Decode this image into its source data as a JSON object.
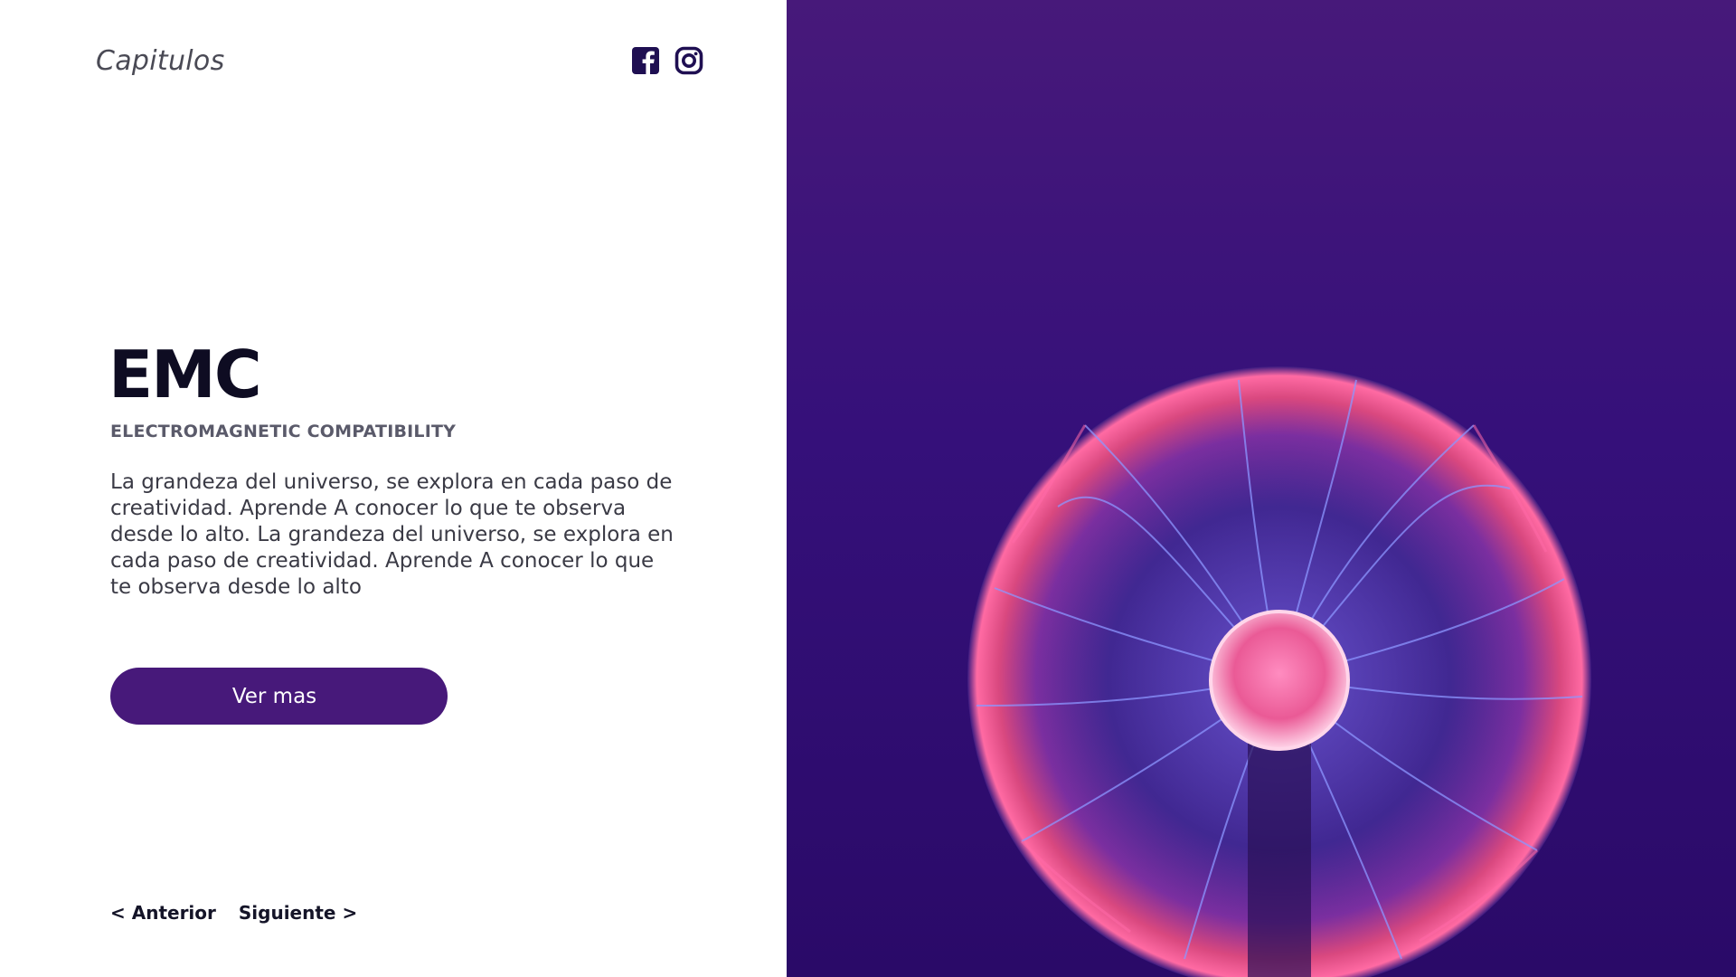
{
  "header": {
    "brand": "Capitulos",
    "social": [
      {
        "icon": "facebook-icon"
      },
      {
        "icon": "instagram-icon"
      }
    ]
  },
  "hero": {
    "title": "EMC",
    "subtitle": "ELECTROMAGNETIC COMPATIBILITY",
    "description": "La grandeza del universo, se explora en cada paso de creatividad. Aprende A conocer lo que te observa desde lo alto. La grandeza del universo, se explora en cada paso de creatividad. Aprende A conocer lo que te observa desde lo alto",
    "cta_label": "Ver mas"
  },
  "pagination": {
    "prev_label": "< Anterior",
    "next_label": "Siguiente >"
  },
  "colors": {
    "accent": "#47197a",
    "panel_top": "#47197a",
    "panel_bottom": "#2a0a68",
    "plasma_pink": "#ff5fa0",
    "plasma_blue": "#6f7bff",
    "title": "#0e0c22"
  },
  "image": {
    "subject": "plasma-ball"
  }
}
